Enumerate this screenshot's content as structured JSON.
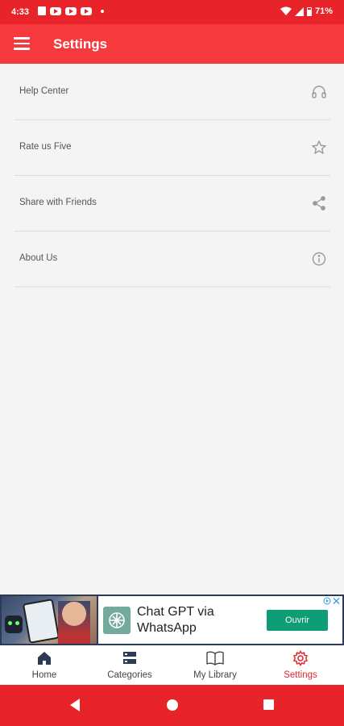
{
  "status_bar": {
    "time": "4:33",
    "battery": "71%"
  },
  "app_bar": {
    "title": "Settings",
    "menu_icon": "hamburger-menu-icon"
  },
  "settings": {
    "items": [
      {
        "label": "Help Center",
        "icon": "headphones-icon"
      },
      {
        "label": "Rate us Five",
        "icon": "star-icon"
      },
      {
        "label": "Share with Friends",
        "icon": "share-icon"
      },
      {
        "label": "About Us",
        "icon": "info-icon"
      }
    ]
  },
  "ad": {
    "headline": "Chat GPT via WhatsApp",
    "cta": "Ouvrir"
  },
  "bottom_nav": {
    "items": [
      {
        "label": "Home",
        "icon": "home-icon"
      },
      {
        "label": "Categories",
        "icon": "categories-icon"
      },
      {
        "label": "My Library",
        "icon": "book-icon"
      },
      {
        "label": "Settings",
        "icon": "gear-icon",
        "active": true
      }
    ]
  },
  "colors": {
    "accent": "#f5393c",
    "status_bar": "#e8232a",
    "active_nav": "#e8232a",
    "ad_cta": "#0f9d75"
  }
}
